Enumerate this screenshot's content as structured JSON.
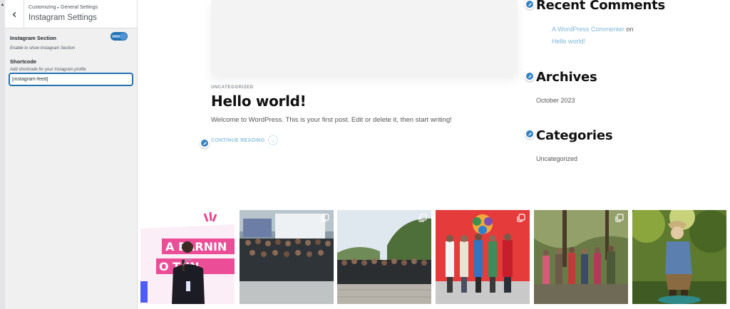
{
  "customizer": {
    "breadcrumb": [
      "Customizing",
      "General Settings"
    ],
    "title": "Instagram Settings",
    "instagram_section": {
      "label": "Instagram Section",
      "description": "Enable to show Instagram Section",
      "enabled": true
    },
    "shortcode": {
      "label": "Shortcode",
      "description": "Add shortcode for your instagram profile",
      "value": "[instagram-feed]"
    }
  },
  "post": {
    "category": "UNCATEGORIZED",
    "title": "Hello world!",
    "excerpt": "Welcome to WordPress. This is your first post. Edit or delete it, then start writing!",
    "continue_label": "CONTINUE READING"
  },
  "sidebar": {
    "recent_comments": {
      "title": "Recent Comments",
      "author": "A WordPress Commenter",
      "on": "on",
      "post": "Hello world!"
    },
    "archives": {
      "title": "Archives",
      "items": [
        "October 2023"
      ]
    },
    "categories": {
      "title": "Categories",
      "items": [
        "Uncategorized"
      ]
    }
  },
  "instagram": {
    "tiles": [
      {
        "name": "speaker-on-stage",
        "multi": true
      },
      {
        "name": "wordcamp-group-banner",
        "multi": true
      },
      {
        "name": "outdoor-group-photo",
        "multi": true
      },
      {
        "name": "wordcamp-asia-group",
        "multi": true
      },
      {
        "name": "hiking-group",
        "multi": true
      },
      {
        "name": "garden-statue",
        "multi": false
      }
    ]
  },
  "colors": {
    "accent": "#2271b1",
    "link": "#7fb7d6",
    "edit_pencil": "#3582c4"
  },
  "icons": [
    "chevron-left-icon",
    "pencil-icon",
    "arrow-right-icon",
    "multiple-photos-icon"
  ]
}
